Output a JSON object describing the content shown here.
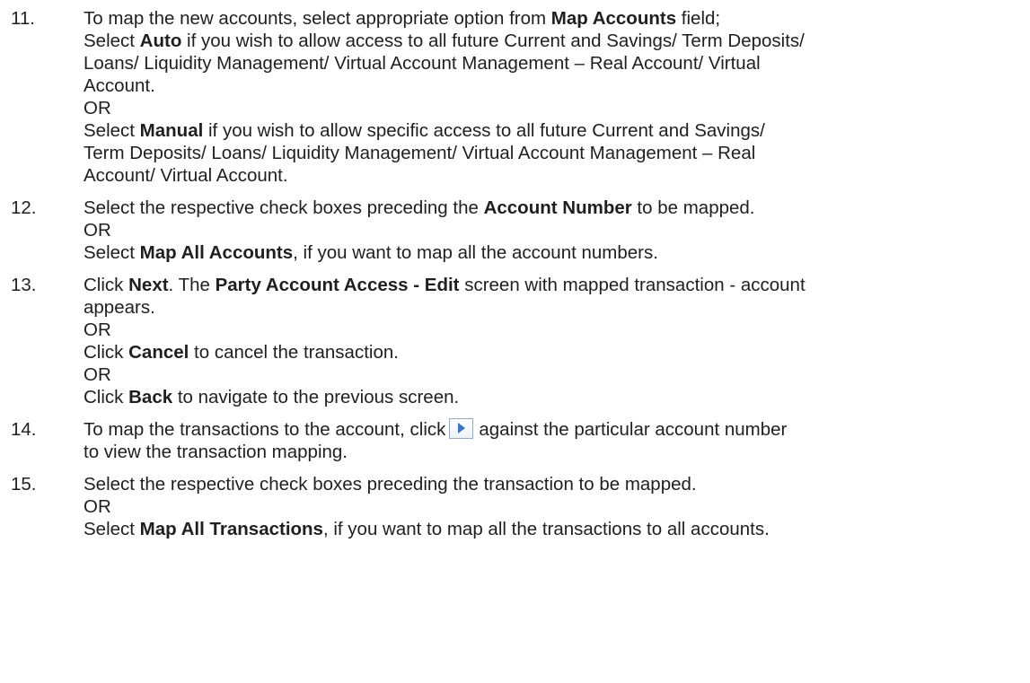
{
  "steps": [
    {
      "number": "11.",
      "lines": [
        {
          "t1": "To map the new accounts, select appropriate option from ",
          "b1": "Map Accounts",
          "t2": " field;"
        },
        {
          "t1": "Select ",
          "b1": "Auto",
          "t2": " if you wish to allow access to all future Current and Savings/ Term Deposits/"
        },
        {
          "t1": "Loans/ Liquidity Management/ Virtual Account Management – Real Account/ Virtual"
        },
        {
          "t1": "Account."
        },
        {
          "t1": "OR"
        },
        {
          "t1": "Select ",
          "b1": "Manual",
          "t2": " if you wish to allow specific access to all future Current and Savings/"
        },
        {
          "t1": "Term Deposits/ Loans/ Liquidity Management/ Virtual Account Management – Real"
        },
        {
          "t1": "Account/ Virtual Account."
        }
      ]
    },
    {
      "number": "12.",
      "lines": [
        {
          "t1": "Select the respective check boxes preceding the ",
          "b1": "Account Number",
          "t2": " to be mapped."
        },
        {
          "t1": "OR"
        },
        {
          "t1": "Select ",
          "b1": "Map All Accounts",
          "t2": ", if you want to map all the account numbers."
        }
      ]
    },
    {
      "number": "13.",
      "lines": [
        {
          "t1": "Click ",
          "b1": "Next",
          "t2": ". The ",
          "b2": "Party Account Access - Edit",
          "t3": " screen with mapped transaction - account"
        },
        {
          "t1": "appears."
        },
        {
          "t1": "OR"
        },
        {
          "t1": "Click ",
          "b1": "Cancel",
          "t2": " to cancel the transaction."
        },
        {
          "t1": "OR"
        },
        {
          "t1": "Click ",
          "b1": "Back",
          "t2": " to navigate to the previous screen."
        }
      ]
    },
    {
      "number": "14.",
      "lines": [
        {
          "t1": "To map the transactions to the account, click",
          "icon": "view-transaction-mapping-icon",
          "t2": "against the particular account number"
        },
        {
          "t1": "to view the transaction mapping."
        }
      ]
    },
    {
      "number": "15.",
      "lines": [
        {
          "t1": "Select the respective check boxes preceding the transaction to be mapped."
        },
        {
          "t1": "OR"
        },
        {
          "t1": "Select ",
          "b1": "Map All Transactions",
          "t2": ", if you want to map all the transactions to all accounts."
        }
      ]
    }
  ]
}
